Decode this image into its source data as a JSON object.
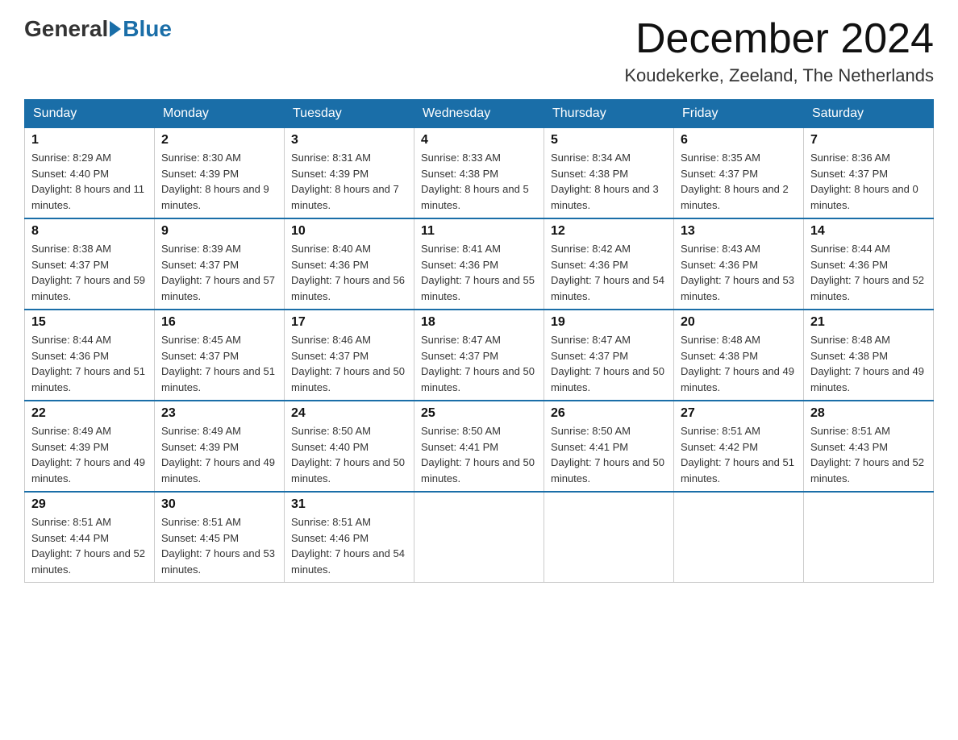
{
  "header": {
    "logo_general": "General",
    "logo_blue": "Blue",
    "page_title": "December 2024",
    "subtitle": "Koudekerke, Zeeland, The Netherlands"
  },
  "weekdays": [
    "Sunday",
    "Monday",
    "Tuesday",
    "Wednesday",
    "Thursday",
    "Friday",
    "Saturday"
  ],
  "weeks": [
    [
      {
        "day": "1",
        "sunrise": "8:29 AM",
        "sunset": "4:40 PM",
        "daylight": "8 hours and 11 minutes."
      },
      {
        "day": "2",
        "sunrise": "8:30 AM",
        "sunset": "4:39 PM",
        "daylight": "8 hours and 9 minutes."
      },
      {
        "day": "3",
        "sunrise": "8:31 AM",
        "sunset": "4:39 PM",
        "daylight": "8 hours and 7 minutes."
      },
      {
        "day": "4",
        "sunrise": "8:33 AM",
        "sunset": "4:38 PM",
        "daylight": "8 hours and 5 minutes."
      },
      {
        "day": "5",
        "sunrise": "8:34 AM",
        "sunset": "4:38 PM",
        "daylight": "8 hours and 3 minutes."
      },
      {
        "day": "6",
        "sunrise": "8:35 AM",
        "sunset": "4:37 PM",
        "daylight": "8 hours and 2 minutes."
      },
      {
        "day": "7",
        "sunrise": "8:36 AM",
        "sunset": "4:37 PM",
        "daylight": "8 hours and 0 minutes."
      }
    ],
    [
      {
        "day": "8",
        "sunrise": "8:38 AM",
        "sunset": "4:37 PM",
        "daylight": "7 hours and 59 minutes."
      },
      {
        "day": "9",
        "sunrise": "8:39 AM",
        "sunset": "4:37 PM",
        "daylight": "7 hours and 57 minutes."
      },
      {
        "day": "10",
        "sunrise": "8:40 AM",
        "sunset": "4:36 PM",
        "daylight": "7 hours and 56 minutes."
      },
      {
        "day": "11",
        "sunrise": "8:41 AM",
        "sunset": "4:36 PM",
        "daylight": "7 hours and 55 minutes."
      },
      {
        "day": "12",
        "sunrise": "8:42 AM",
        "sunset": "4:36 PM",
        "daylight": "7 hours and 54 minutes."
      },
      {
        "day": "13",
        "sunrise": "8:43 AM",
        "sunset": "4:36 PM",
        "daylight": "7 hours and 53 minutes."
      },
      {
        "day": "14",
        "sunrise": "8:44 AM",
        "sunset": "4:36 PM",
        "daylight": "7 hours and 52 minutes."
      }
    ],
    [
      {
        "day": "15",
        "sunrise": "8:44 AM",
        "sunset": "4:36 PM",
        "daylight": "7 hours and 51 minutes."
      },
      {
        "day": "16",
        "sunrise": "8:45 AM",
        "sunset": "4:37 PM",
        "daylight": "7 hours and 51 minutes."
      },
      {
        "day": "17",
        "sunrise": "8:46 AM",
        "sunset": "4:37 PM",
        "daylight": "7 hours and 50 minutes."
      },
      {
        "day": "18",
        "sunrise": "8:47 AM",
        "sunset": "4:37 PM",
        "daylight": "7 hours and 50 minutes."
      },
      {
        "day": "19",
        "sunrise": "8:47 AM",
        "sunset": "4:37 PM",
        "daylight": "7 hours and 50 minutes."
      },
      {
        "day": "20",
        "sunrise": "8:48 AM",
        "sunset": "4:38 PM",
        "daylight": "7 hours and 49 minutes."
      },
      {
        "day": "21",
        "sunrise": "8:48 AM",
        "sunset": "4:38 PM",
        "daylight": "7 hours and 49 minutes."
      }
    ],
    [
      {
        "day": "22",
        "sunrise": "8:49 AM",
        "sunset": "4:39 PM",
        "daylight": "7 hours and 49 minutes."
      },
      {
        "day": "23",
        "sunrise": "8:49 AM",
        "sunset": "4:39 PM",
        "daylight": "7 hours and 49 minutes."
      },
      {
        "day": "24",
        "sunrise": "8:50 AM",
        "sunset": "4:40 PM",
        "daylight": "7 hours and 50 minutes."
      },
      {
        "day": "25",
        "sunrise": "8:50 AM",
        "sunset": "4:41 PM",
        "daylight": "7 hours and 50 minutes."
      },
      {
        "day": "26",
        "sunrise": "8:50 AM",
        "sunset": "4:41 PM",
        "daylight": "7 hours and 50 minutes."
      },
      {
        "day": "27",
        "sunrise": "8:51 AM",
        "sunset": "4:42 PM",
        "daylight": "7 hours and 51 minutes."
      },
      {
        "day": "28",
        "sunrise": "8:51 AM",
        "sunset": "4:43 PM",
        "daylight": "7 hours and 52 minutes."
      }
    ],
    [
      {
        "day": "29",
        "sunrise": "8:51 AM",
        "sunset": "4:44 PM",
        "daylight": "7 hours and 52 minutes."
      },
      {
        "day": "30",
        "sunrise": "8:51 AM",
        "sunset": "4:45 PM",
        "daylight": "7 hours and 53 minutes."
      },
      {
        "day": "31",
        "sunrise": "8:51 AM",
        "sunset": "4:46 PM",
        "daylight": "7 hours and 54 minutes."
      },
      null,
      null,
      null,
      null
    ]
  ]
}
